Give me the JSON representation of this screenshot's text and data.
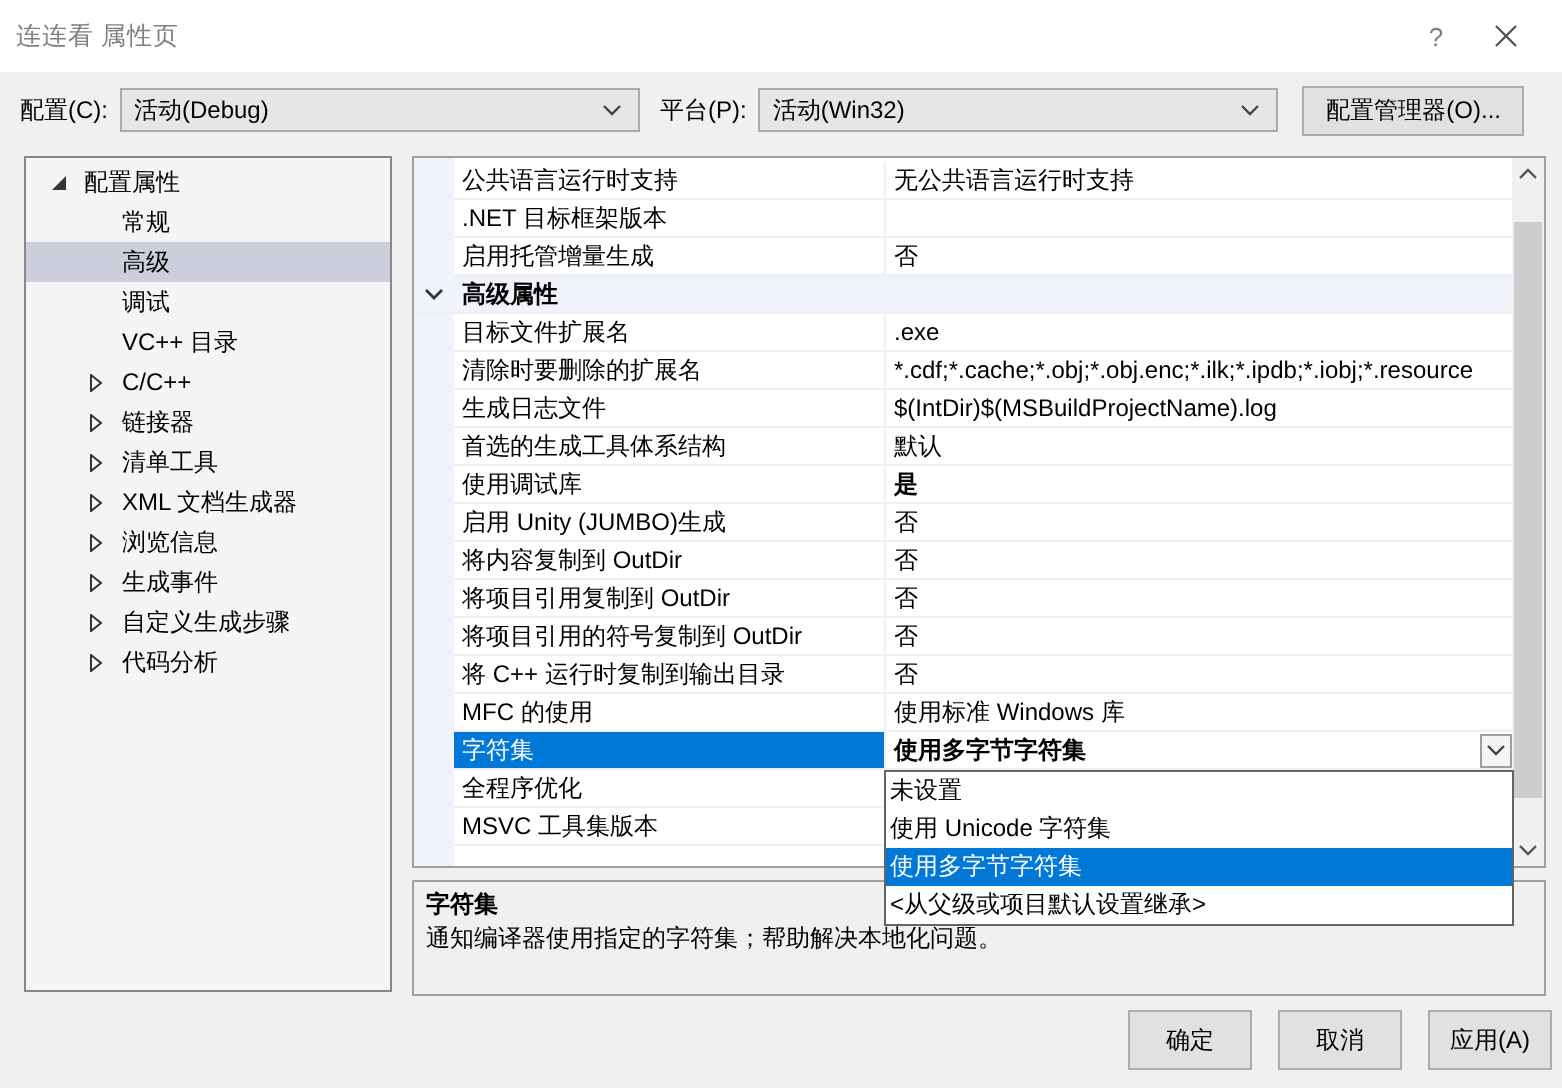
{
  "window": {
    "title": "连连看 属性页",
    "help": "?"
  },
  "config": {
    "label": "配置(C):",
    "value": "活动(Debug)"
  },
  "platform": {
    "label": "平台(P):",
    "value": "活动(Win32)"
  },
  "config_manager_button": "配置管理器(O)...",
  "tree": [
    {
      "label": "配置属性",
      "expanded": true,
      "selected": false,
      "children": [
        {
          "label": "常规",
          "selected": false
        },
        {
          "label": "高级",
          "selected": true
        },
        {
          "label": "调试",
          "selected": false
        },
        {
          "label": "VC++ 目录",
          "selected": false
        },
        {
          "label": "C/C++",
          "expanded": false,
          "selected": false
        },
        {
          "label": "链接器",
          "expanded": false,
          "selected": false
        },
        {
          "label": "清单工具",
          "expanded": false,
          "selected": false
        },
        {
          "label": "XML 文档生成器",
          "expanded": false,
          "selected": false
        },
        {
          "label": "浏览信息",
          "expanded": false,
          "selected": false
        },
        {
          "label": "生成事件",
          "expanded": false,
          "selected": false
        },
        {
          "label": "自定义生成步骤",
          "expanded": false,
          "selected": false
        },
        {
          "label": "代码分析",
          "expanded": false,
          "selected": false
        }
      ]
    }
  ],
  "properties": [
    {
      "kind": "property",
      "name": "公共语言运行时支持",
      "value": "无公共语言运行时支持",
      "modified": false,
      "selected": false
    },
    {
      "kind": "property",
      "name": ".NET 目标框架版本",
      "selected": false
    },
    {
      "kind": "property",
      "name": "启用托管增量生成",
      "value": "否",
      "modified": false,
      "selected": false
    },
    {
      "kind": "category",
      "name": "高级属性",
      "expanded": true
    },
    {
      "kind": "property",
      "name": "目标文件扩展名",
      "value": ".exe",
      "modified": false,
      "selected": false
    },
    {
      "kind": "property",
      "name": "清除时要删除的扩展名",
      "value": "*.cdf;*.cache;*.obj;*.obj.enc;*.ilk;*.ipdb;*.iobj;*.resource",
      "modified": false,
      "selected": false
    },
    {
      "kind": "property",
      "name": "生成日志文件",
      "value": "$(IntDir)$(MSBuildProjectName).log",
      "modified": false,
      "selected": false
    },
    {
      "kind": "property",
      "name": "首选的生成工具体系结构",
      "value": "默认",
      "modified": false,
      "selected": false
    },
    {
      "kind": "property",
      "name": "使用调试库",
      "value": "是",
      "modified": true,
      "selected": false
    },
    {
      "kind": "property",
      "name": "启用 Unity (JUMBO)生成",
      "value": "否",
      "modified": false,
      "selected": false
    },
    {
      "kind": "property",
      "name": "将内容复制到 OutDir",
      "value": "否",
      "modified": false,
      "selected": false
    },
    {
      "kind": "property",
      "name": "将项目引用复制到 OutDir",
      "value": "否",
      "modified": false,
      "selected": false
    },
    {
      "kind": "property",
      "name": "将项目引用的符号复制到 OutDir",
      "value": "否",
      "modified": false,
      "selected": false
    },
    {
      "kind": "property",
      "name": "将 C++ 运行时复制到输出目录",
      "value": "否",
      "modified": false,
      "selected": false
    },
    {
      "kind": "property",
      "name": "MFC 的使用",
      "value": "使用标准 Windows 库",
      "modified": false,
      "selected": false
    },
    {
      "kind": "property",
      "name": "字符集",
      "value": "使用多字节字符集",
      "modified": true,
      "selected": true
    },
    {
      "kind": "property",
      "name": "全程序优化",
      "selected": false
    },
    {
      "kind": "property",
      "name": "MSVC 工具集版本",
      "selected": false
    }
  ],
  "dropdown_options": [
    {
      "label": "未设置",
      "selected": false
    },
    {
      "label": "使用 Unicode 字符集",
      "selected": false
    },
    {
      "label": "使用多字节字符集",
      "selected": true
    },
    {
      "label": "<从父级或项目默认设置继承>",
      "selected": false
    }
  ],
  "description": {
    "title": "字符集",
    "text": "通知编译器使用指定的字符集；帮助解决本地化问题。"
  },
  "buttons": [
    "确定",
    "取消",
    "应用(A)"
  ]
}
